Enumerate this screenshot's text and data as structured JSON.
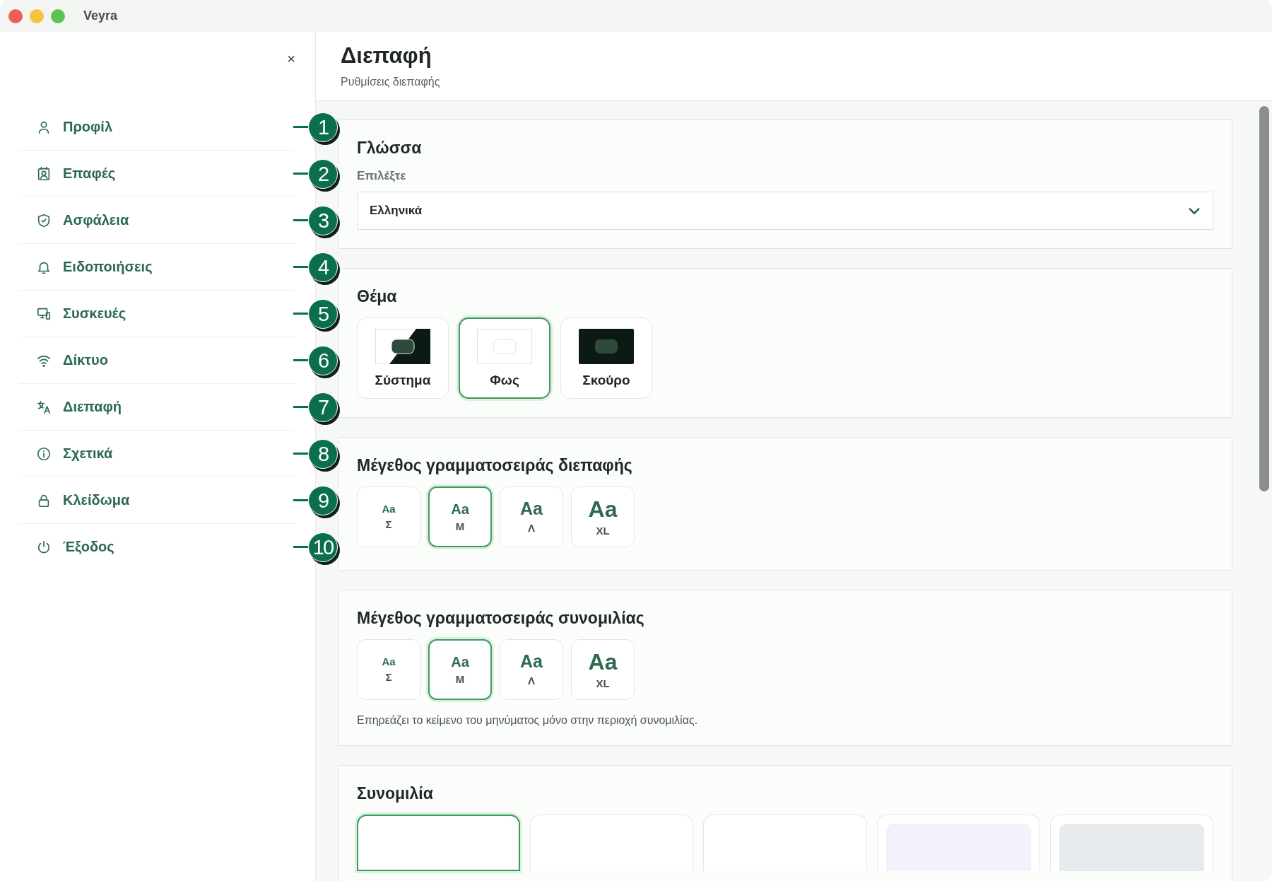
{
  "window": {
    "title": "Veyra"
  },
  "sidebar": {
    "close": "×",
    "items": [
      {
        "label": "Προφίλ",
        "callout": "1"
      },
      {
        "label": "Επαφές",
        "callout": "2"
      },
      {
        "label": "Ασφάλεια",
        "callout": "3"
      },
      {
        "label": "Ειδοποιήσεις",
        "callout": "4"
      },
      {
        "label": "Συσκευές",
        "callout": "5"
      },
      {
        "label": "Δίκτυο",
        "callout": "6"
      },
      {
        "label": "Διεπαφή",
        "callout": "7"
      },
      {
        "label": "Σχετικά",
        "callout": "8"
      },
      {
        "label": "Κλείδωμα",
        "callout": "9"
      },
      {
        "label": "Έξοδος",
        "callout": "10"
      }
    ]
  },
  "header": {
    "title": "Διεπαφή",
    "subtitle": "Ρυθμίσεις διεπαφής"
  },
  "language": {
    "title": "Γλώσσα",
    "label": "Επιλέξτε",
    "value": "Ελληνικά"
  },
  "theme": {
    "title": "Θέμα",
    "options": [
      {
        "label": "Σύστημα",
        "kind": "system",
        "selected": false
      },
      {
        "label": "Φως",
        "kind": "light",
        "selected": true
      },
      {
        "label": "Σκούρο",
        "kind": "dark",
        "selected": false
      }
    ]
  },
  "ui_font": {
    "title": "Μέγεθος γραμματοσειράς διεπαφής",
    "options": [
      {
        "sample": "Aa",
        "label": "Σ",
        "selected": false
      },
      {
        "sample": "Aa",
        "label": "Μ",
        "selected": true
      },
      {
        "sample": "Aa",
        "label": "Λ",
        "selected": false
      },
      {
        "sample": "Aa",
        "label": "XL",
        "selected": false
      }
    ]
  },
  "chat_font": {
    "title": "Μέγεθος γραμματοσειράς συνομιλίας",
    "options": [
      {
        "sample": "Aa",
        "label": "Σ",
        "selected": false
      },
      {
        "sample": "Aa",
        "label": "Μ",
        "selected": true
      },
      {
        "sample": "Aa",
        "label": "Λ",
        "selected": false
      },
      {
        "sample": "Aa",
        "label": "XL",
        "selected": false
      }
    ],
    "note": "Επηρεάζει το κείμενο του μηνύματος μόνο στην περιοχή συνομιλίας."
  },
  "chat": {
    "title": "Συνομιλία",
    "options": [
      {
        "selected": true
      },
      {
        "selected": false
      },
      {
        "selected": false
      },
      {
        "selected": false,
        "color": "#f3f2fc"
      },
      {
        "selected": false,
        "color": "#e8ebee"
      }
    ]
  }
}
